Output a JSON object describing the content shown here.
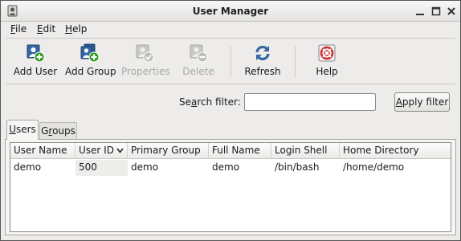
{
  "window": {
    "title": "User Manager"
  },
  "menubar": {
    "file": {
      "mnemonic": "F",
      "rest": "ile"
    },
    "edit": {
      "mnemonic": "E",
      "rest": "dit"
    },
    "help": {
      "mnemonic": "H",
      "rest": "elp"
    }
  },
  "toolbar": {
    "add_user": "Add User",
    "add_group": "Add Group",
    "properties": "Properties",
    "delete": "Delete",
    "refresh": "Refresh",
    "help": "Help"
  },
  "search": {
    "label_pre": "Se",
    "label_mnemonic": "a",
    "label_post": "rch filter:",
    "value": "",
    "apply_mnemonic": "A",
    "apply_rest": "pply filter"
  },
  "tabs": {
    "users": {
      "mnemonic": "U",
      "rest": "sers"
    },
    "groups": {
      "pre": "G",
      "mnemonic": "r",
      "rest": "oups"
    }
  },
  "table": {
    "columns": [
      "User Name",
      "User ID",
      "Primary Group",
      "Full Name",
      "Login Shell",
      "Home Directory"
    ],
    "rows": [
      [
        "demo",
        "500",
        "demo",
        "demo",
        "/bin/bash",
        "/home/demo"
      ]
    ]
  },
  "colors": {
    "enabled_icon_blue": "#3465a4",
    "add_green": "#2e9a1e",
    "help_red": "#cc2a2a"
  }
}
